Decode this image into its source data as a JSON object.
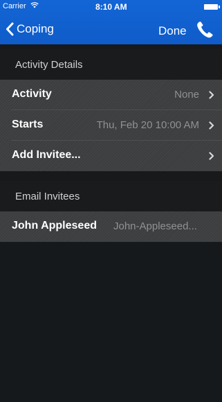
{
  "status_bar": {
    "carrier": "Carrier",
    "time": "8:10 AM",
    "wifi_icon": "wifi-icon",
    "battery_icon": "battery-icon"
  },
  "nav": {
    "back_label": "Coping",
    "done_label": "Done",
    "call_icon": "phone-icon",
    "bar_color": "#1365d6"
  },
  "activity_details": {
    "header": "Activity Details",
    "rows": [
      {
        "label": "Activity",
        "value": "None"
      },
      {
        "label": "Starts",
        "value": "Thu, Feb 20 10:00 AM"
      },
      {
        "label": "Add Invitee...",
        "value": ""
      }
    ]
  },
  "email_invitees": {
    "header": "Email Invitees",
    "rows": [
      {
        "name": "John Appleseed",
        "email": "John-Appleseed..."
      }
    ]
  }
}
